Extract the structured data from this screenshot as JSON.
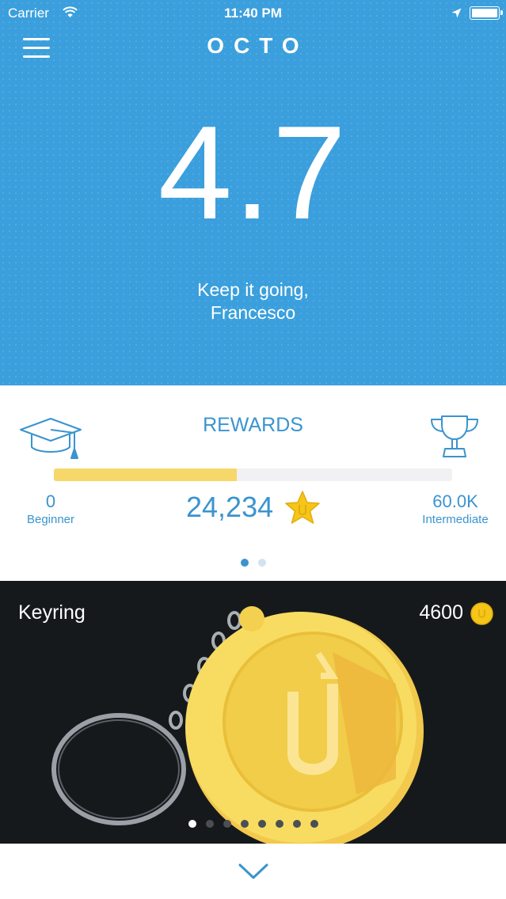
{
  "status_bar": {
    "carrier": "Carrier",
    "time": "11:40 PM"
  },
  "header": {
    "logo": "OCTO",
    "menu_icon": "hamburger-menu-icon"
  },
  "hero": {
    "score": "4.7",
    "greeting_line1": "Keep it going,",
    "greeting_line2": "Francesco"
  },
  "rewards": {
    "title": "REWARDS",
    "start_level": {
      "value": "0",
      "name": "Beginner"
    },
    "end_level": {
      "value": "60.0K",
      "name": "Intermediate"
    },
    "points": "24,234",
    "progress_fraction": 0.46,
    "page_count": 2,
    "active_page": 0
  },
  "product": {
    "name": "Keyring",
    "price": "4600",
    "slide_count": 8,
    "active_slide": 0
  },
  "colors": {
    "hero_blue": "#3a9fdc",
    "accent_blue": "#3a94cf",
    "progress_yellow": "#f6d86a",
    "coin_gold": "#f5c518",
    "dark_bg": "#16191c"
  }
}
